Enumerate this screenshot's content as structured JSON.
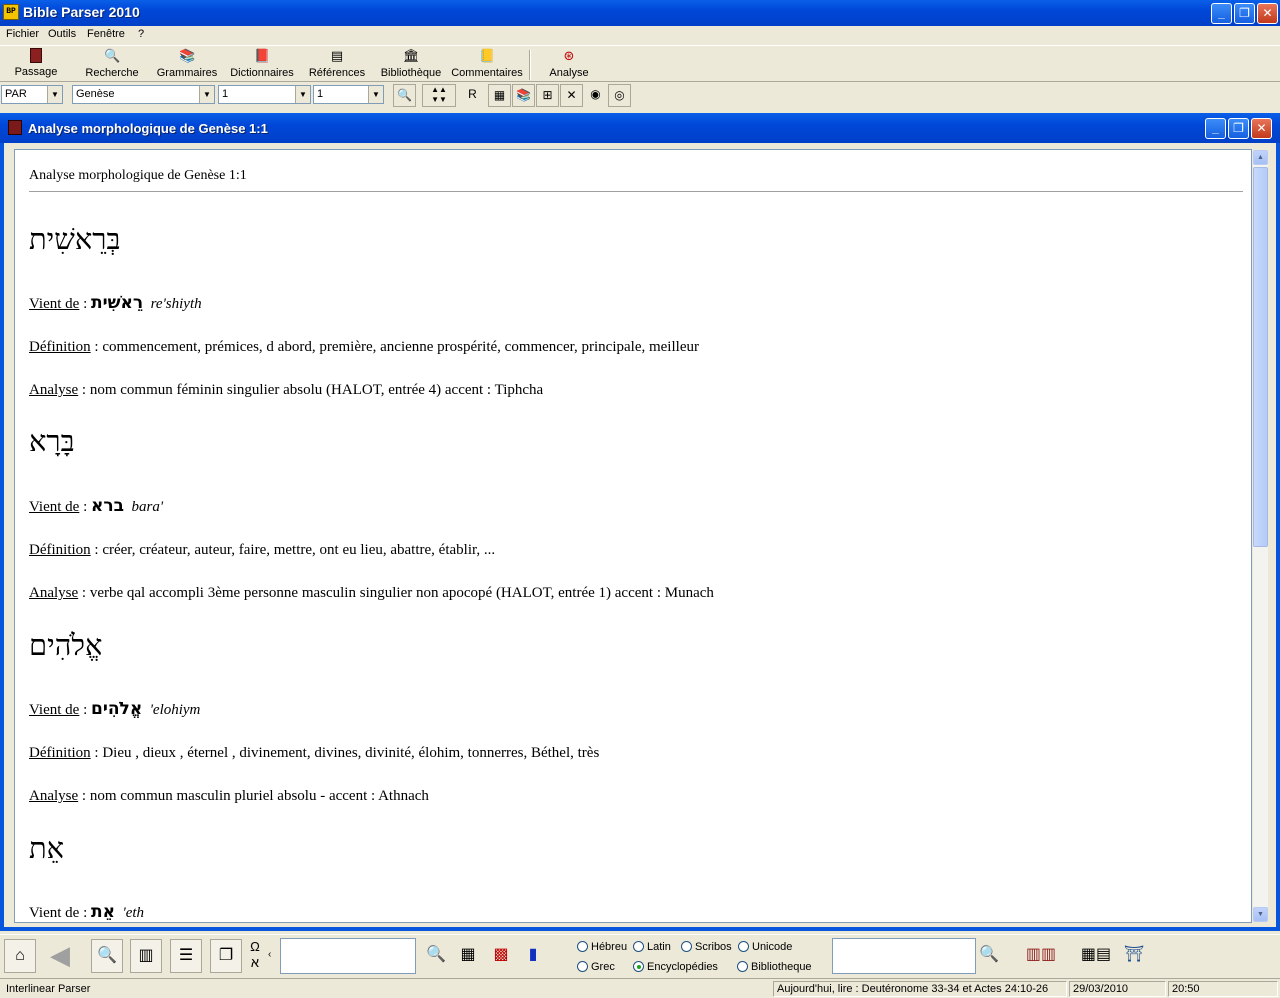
{
  "window": {
    "title": "Bible Parser 2010",
    "app_icon": "BP",
    "buttons": {
      "minimize": "_",
      "restore": "❐",
      "close": "✕"
    }
  },
  "menu": [
    "Fichier",
    "Outils",
    "Fenêtre",
    "?"
  ],
  "toolbar": [
    {
      "label": "Passage",
      "icon": "book-icon"
    },
    {
      "label": "Recherche",
      "icon": "search-icon"
    },
    {
      "label": "Grammaires",
      "icon": "grammar-books-icon"
    },
    {
      "label": "Dictionnaires",
      "icon": "dictionary-icon"
    },
    {
      "label": "Références",
      "icon": "references-icon"
    },
    {
      "label": "Bibliothèque",
      "icon": "library-icon"
    },
    {
      "label": "Commentaires",
      "icon": "commentary-icon"
    },
    {
      "label": "Analyse",
      "icon": "analysis-icon"
    }
  ],
  "navigation": {
    "version": "PAR",
    "book": "Genèse",
    "chapter": "1",
    "verse": "1",
    "r_label": "R"
  },
  "child_window": {
    "title": "Analyse morphologique de Genèse 1:1"
  },
  "analysis": {
    "heading": "Analyse morphologique de Genèse 1:1",
    "labels": {
      "from": "Vient de",
      "definition": "Définition",
      "analysis": "Analyse",
      "sep": " : "
    },
    "words": [
      {
        "hebrew": "בְּרֵאשִׁית",
        "root": "רֵאשִׁית",
        "translit": "re'shiyth",
        "definition": "commencement, prémices, d abord, première, ancienne prospérité, commencer, principale, meilleur",
        "analysis": "nom commun féminin singulier absolu (HALOT, entrée 4) accent : Tiphcha"
      },
      {
        "hebrew": "בָּרָא",
        "root": "ברא",
        "translit": "bara'",
        "definition": "créer, créateur, auteur, faire, mettre, ont eu lieu, abattre, établir, ...",
        "analysis": "verbe qal accompli 3ème personne masculin singulier non apocopé (HALOT, entrée 1) accent : Munach"
      },
      {
        "hebrew": "אֱלֹהִים",
        "root": "אֱלֹהִים",
        "translit": "'elohiym",
        "definition": "Dieu , dieux , éternel , divinement, divines, divinité, élohim, tonnerres, Béthel, très",
        "analysis": "nom commun masculin pluriel absolu - accent : Athnach"
      },
      {
        "hebrew": "אֵת",
        "root": "אֵת",
        "translit": "'eth"
      }
    ]
  },
  "bottom": {
    "omega": "Ω",
    "aleph": "א",
    "radios": [
      {
        "label": "Hébreu",
        "checked": false
      },
      {
        "label": "Latin",
        "checked": false
      },
      {
        "label": "Scribos",
        "checked": false
      },
      {
        "label": "Unicode",
        "checked": false
      },
      {
        "label": "Grec",
        "checked": false
      },
      {
        "label": "Encyclopédies",
        "checked": true
      },
      {
        "label": "Bibliotheque",
        "checked": false
      }
    ]
  },
  "status": {
    "left": "Interlinear Parser",
    "reading": "Aujourd'hui, lire : Deutéronome 33-34 et Actes 24:10-26",
    "date": "29/03/2010",
    "time": "20:50"
  }
}
